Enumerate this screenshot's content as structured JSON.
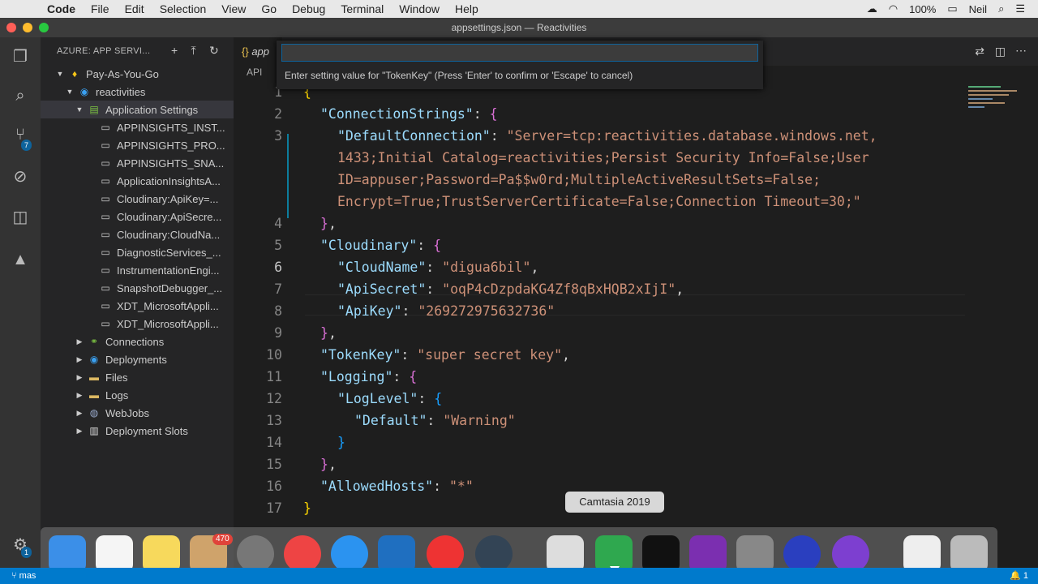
{
  "menubar": {
    "app": "Code",
    "items": [
      "File",
      "Edit",
      "Selection",
      "View",
      "Go",
      "Debug",
      "Terminal",
      "Window",
      "Help"
    ],
    "battery": "100%",
    "user": "Neil"
  },
  "window": {
    "title": "appsettings.json — Reactivities"
  },
  "activity": {
    "source_control_badge": "7",
    "settings_badge": "1"
  },
  "sidebar": {
    "header": "AZURE: APP SERVI...",
    "subscription": "Pay-As-You-Go",
    "app": "reactivities",
    "app_settings": "Application Settings",
    "settings": [
      "APPINSIGHTS_INST...",
      "APPINSIGHTS_PRO...",
      "APPINSIGHTS_SNA...",
      "ApplicationInsightsA...",
      "Cloudinary:ApiKey=...",
      "Cloudinary:ApiSecre...",
      "Cloudinary:CloudNa...",
      "DiagnosticServices_...",
      "InstrumentationEngi...",
      "SnapshotDebugger_...",
      "XDT_MicrosoftAppli...",
      "XDT_MicrosoftAppli..."
    ],
    "groups": [
      "Connections",
      "Deployments",
      "Files",
      "Logs",
      "WebJobs",
      "Deployment Slots"
    ]
  },
  "editor": {
    "tab": "app",
    "breadcrumb": "API",
    "quick_input": {
      "value": "",
      "prompt": "Enter setting value for \"TokenKey\" (Press 'Enter' to confirm or 'Escape' to cancel)"
    },
    "current_line": 6,
    "line_numbers": [
      "1",
      "2",
      "3",
      "4",
      "5",
      "6",
      "7",
      "8",
      "9",
      "10",
      "11",
      "12",
      "13",
      "14",
      "15",
      "16",
      "17"
    ],
    "code": {
      "l1": "{",
      "l2k": "\"ConnectionStrings\"",
      "l3k": "\"DefaultConnection\"",
      "l3v_a": "\"Server=tcp:reactivities.database.windows.net,",
      "l3v_b": "1433;Initial Catalog=reactivities;Persist Security Info=False;User",
      "l3v_c": "ID=appuser;Password=Pa$$w0rd;MultipleActiveResultSets=False;",
      "l3v_d": "Encrypt=True;TrustServerCertificate=False;Connection Timeout=30;\"",
      "l5k": "\"Cloudinary\"",
      "l6k": "\"CloudName\"",
      "l6v": "\"digua6bil\"",
      "l7k": "\"ApiSecret\"",
      "l7v": "\"oqP4cDzpdaKG4Zf8qBxHQB2xIjI\"",
      "l8k": "\"ApiKey\"",
      "l8v": "\"269272975632736\"",
      "l10k": "\"TokenKey\"",
      "l10v": "\"super secret key\"",
      "l11k": "\"Logging\"",
      "l12k": "\"LogLevel\"",
      "l13k": "\"Default\"",
      "l13v": "\"Warning\"",
      "l16k": "\"AllowedHosts\"",
      "l16v": "\"*\"",
      "l17": "}"
    }
  },
  "dock": {
    "mail_badge": "470",
    "tooltip": "Camtasia 2019"
  },
  "statusbar": {
    "branch": "mas",
    "notifications": "1"
  }
}
